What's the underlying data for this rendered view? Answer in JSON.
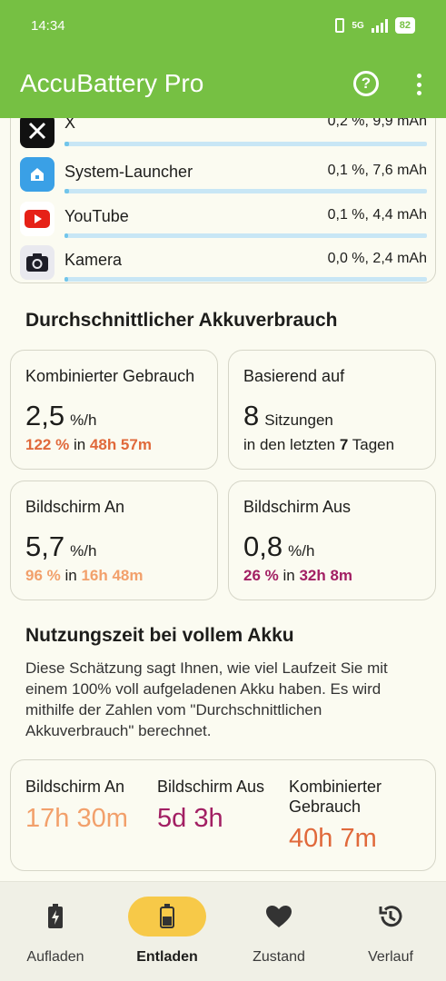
{
  "status_bar": {
    "time": "14:34",
    "network": "5G",
    "battery": "82"
  },
  "app_bar": {
    "title": "AccuBattery Pro",
    "help_icon": "help-circle-icon",
    "menu_icon": "more-vertical-icon"
  },
  "app_usage": [
    {
      "name": "X",
      "value": "0,2 %, 9,9 mAh",
      "fill": 0.012,
      "icon": "x-logo-icon"
    },
    {
      "name": "System-Launcher",
      "value": "0,1 %, 7,6 mAh",
      "fill": 0.012,
      "icon": "home-icon"
    },
    {
      "name": "YouTube",
      "value": "0,1 %, 4,4 mAh",
      "fill": 0.01,
      "icon": "youtube-icon"
    },
    {
      "name": "Kamera",
      "value": "0,0 %, 2,4 mAh",
      "fill": 0.005,
      "icon": "camera-icon"
    }
  ],
  "avg_usage": {
    "title": "Durchschnittlicher Akkuverbrauch",
    "combined": {
      "label": "Kombinierter Gebrauch",
      "value": "2,5",
      "unit": "%/h",
      "pct": "122 %",
      "in": "in",
      "time": "48h 57m"
    },
    "based_on": {
      "label": "Basierend auf",
      "value": "8",
      "sessions": "Sitzungen",
      "prefix": "in den letzten",
      "days": "7",
      "suffix": "Tagen"
    },
    "screen_on": {
      "label": "Bildschirm An",
      "value": "5,7",
      "unit": "%/h",
      "pct": "96 %",
      "in": "in",
      "time": "16h 48m"
    },
    "screen_off": {
      "label": "Bildschirm Aus",
      "value": "0,8",
      "unit": "%/h",
      "pct": "26 %",
      "in": "in",
      "time": "32h 8m"
    }
  },
  "full_charge": {
    "title": "Nutzungszeit bei vollem Akku",
    "description": "Diese Schätzung sagt Ihnen, wie viel Laufzeit Sie mit einem 100% voll aufgeladenen Akku haben. Es wird mithilfe der Zahlen vom \"Durchschnittlichen Akkuverbrauch\" berechnet.",
    "screen_on": {
      "label": "Bildschirm An",
      "value": "17h 30m"
    },
    "screen_off": {
      "label": "Bildschirm Aus",
      "value": "5d 3h"
    },
    "combined": {
      "label": "Kombinierter Gebrauch",
      "value": "40h 7m"
    }
  },
  "nav": [
    {
      "label": "Aufladen",
      "icon": "battery-charging-icon",
      "active": false
    },
    {
      "label": "Entladen",
      "icon": "battery-discharging-icon",
      "active": true
    },
    {
      "label": "Zustand",
      "icon": "heart-icon",
      "active": false
    },
    {
      "label": "Verlauf",
      "icon": "history-icon",
      "active": false
    }
  ],
  "colors": {
    "accent": "#76c043",
    "orange": "#e0693b",
    "light_orange": "#f2a06b",
    "purple": "#a21f63",
    "active_nav": "#f7c948",
    "bar": "#72c5ea"
  }
}
